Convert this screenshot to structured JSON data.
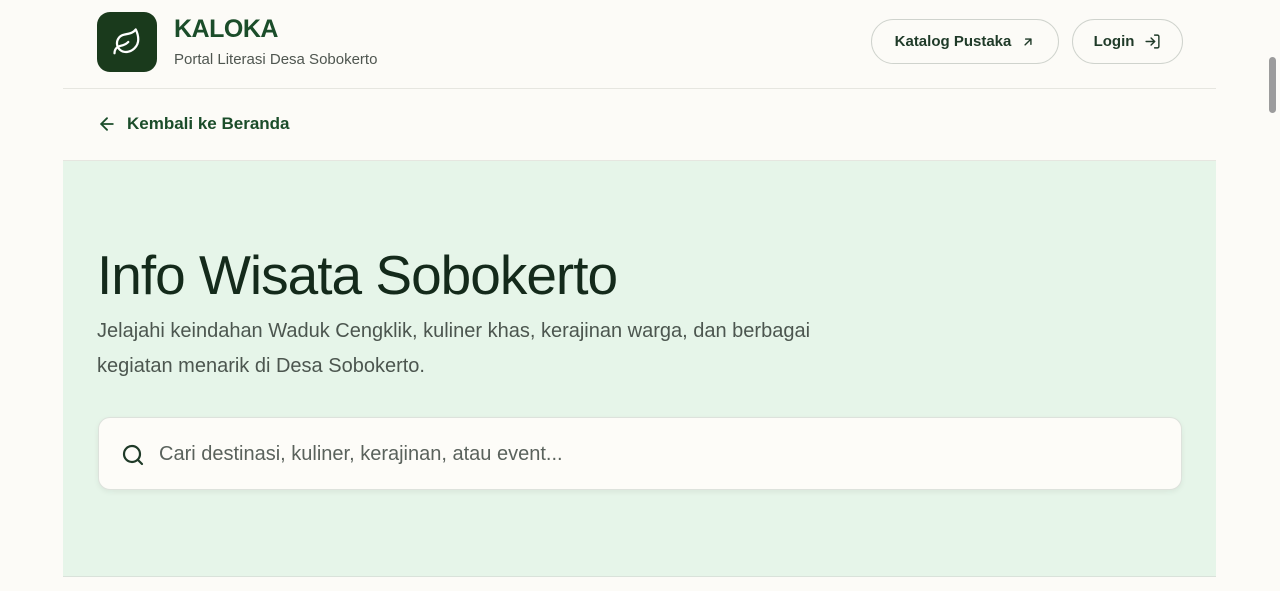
{
  "header": {
    "brand_title": "KALOKA",
    "brand_subtitle": "Portal Literasi Desa Sobokerto",
    "logo_icon": "leaf-icon",
    "buttons": {
      "katalog_label": "Katalog Pustaka",
      "katalog_icon": "arrow-up-right-icon",
      "login_label": "Login",
      "login_icon": "login-icon"
    }
  },
  "back_link": {
    "label": "Kembali ke Beranda",
    "icon": "arrow-left-icon"
  },
  "hero": {
    "title": "Info Wisata Sobokerto",
    "description": "Jelajahi keindahan Waduk Cengklik, kuliner khas, kerajinan warga, dan berbagai kegiatan menarik di Desa Sobokerto.",
    "search": {
      "placeholder": "Cari destinasi, kuliner, kerajinan, atau event...",
      "value": "",
      "icon": "search-icon"
    }
  },
  "colors": {
    "brand_dark": "#1a3a1c",
    "brand_text": "#1b4d2a",
    "hero_bg": "#e6f5e9",
    "page_bg": "#fcfbf7"
  }
}
